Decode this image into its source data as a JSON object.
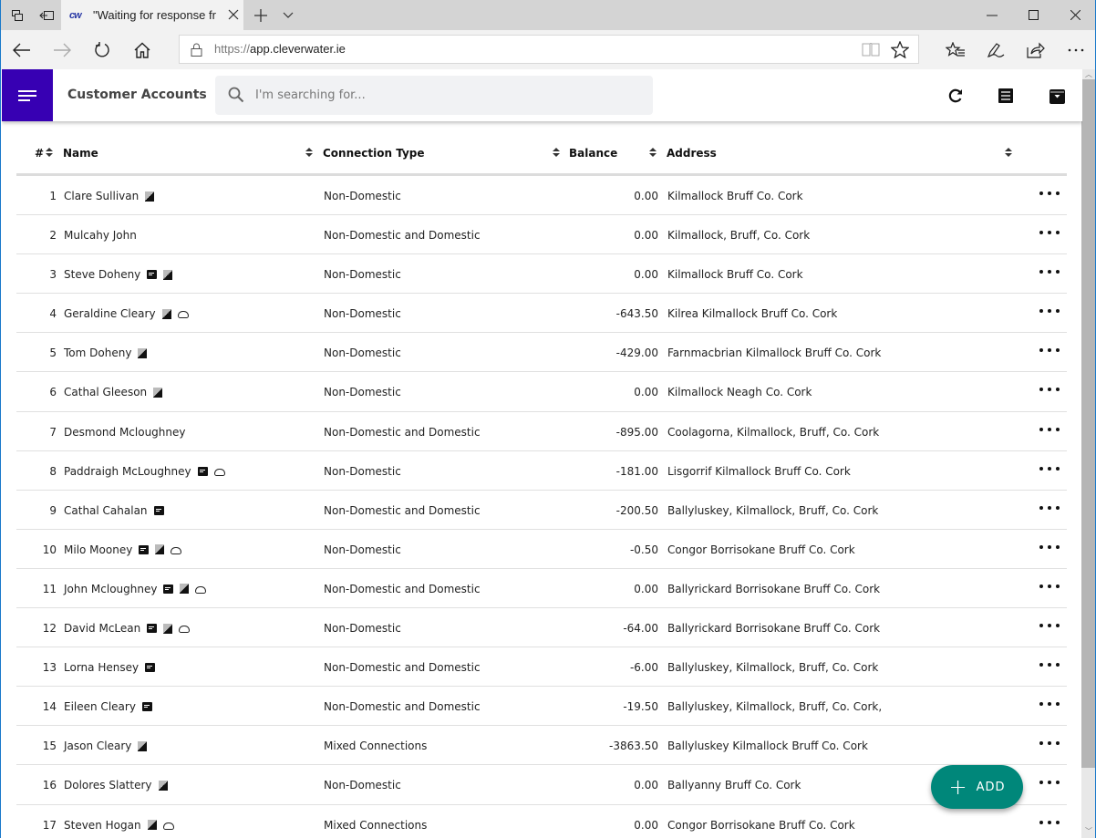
{
  "browser": {
    "tab_title": "\"Waiting for response fr",
    "tab_favicon": "cw",
    "url_scheme": "https://",
    "url_host": "app.cleverwater.ie",
    "icons": [
      "tab-set-aside-icon",
      "tab-restore-icon",
      "close-icon",
      "new-tab-icon",
      "tab-list-chevron-icon",
      "minimize-icon",
      "maximize-icon",
      "close-window-icon",
      "back-icon",
      "forward-icon",
      "refresh-icon",
      "home-icon",
      "lock-icon",
      "reading-view-icon",
      "favorite-star-icon",
      "favorites-hub-icon",
      "web-note-icon",
      "share-icon",
      "more-icon"
    ]
  },
  "app": {
    "title": "Customer Accounts",
    "search_placeholder": "I'm searching for...",
    "header_icons": [
      "refresh-icon",
      "list-icon",
      "archive-icon"
    ],
    "brand_color": "#3700b3",
    "fab_color": "#00877a",
    "fab_label": "ADD"
  },
  "table": {
    "columns": {
      "num": "#",
      "name": "Name",
      "connection": "Connection Type",
      "balance": "Balance",
      "address": "Address"
    },
    "rows": [
      {
        "num": "1",
        "name": "Clare Sullivan",
        "icons": [
          "meter"
        ],
        "connection": "Non-Domestic",
        "balance": "0.00",
        "address": "Kilmallock Bruff Co. Cork"
      },
      {
        "num": "2",
        "name": "Mulcahy John",
        "icons": [],
        "connection": "Non-Domestic and Domestic",
        "balance": "0.00",
        "address": "Kilmallock, Bruff, Co. Cork"
      },
      {
        "num": "3",
        "name": "Steve Doheny",
        "icons": [
          "note",
          "meter"
        ],
        "connection": "Non-Domestic",
        "balance": "0.00",
        "address": "Kilmallock Bruff Co. Cork"
      },
      {
        "num": "4",
        "name": "Geraldine Cleary",
        "icons": [
          "meter",
          "cloud"
        ],
        "connection": "Non-Domestic",
        "balance": "-643.50",
        "address": "Kilrea Kilmallock Bruff Co. Cork"
      },
      {
        "num": "5",
        "name": "Tom Doheny",
        "icons": [
          "meter"
        ],
        "connection": "Non-Domestic",
        "balance": "-429.00",
        "address": "Farnmacbrian Kilmallock Bruff Co. Cork"
      },
      {
        "num": "6",
        "name": "Cathal Gleeson",
        "icons": [
          "meter"
        ],
        "connection": "Non-Domestic",
        "balance": "0.00",
        "address": "Kilmallock Neagh Co. Cork"
      },
      {
        "num": "7",
        "name": "Desmond Mcloughney",
        "icons": [],
        "connection": "Non-Domestic and Domestic",
        "balance": "-895.00",
        "address": "Coolagorna, Kilmallock, Bruff, Co. Cork"
      },
      {
        "num": "8",
        "name": "Paddraigh McLoughney",
        "icons": [
          "note",
          "cloud"
        ],
        "connection": "Non-Domestic",
        "balance": "-181.00",
        "address": "Lisgorrif Kilmallock Bruff Co. Cork"
      },
      {
        "num": "9",
        "name": "Cathal Cahalan",
        "icons": [
          "note"
        ],
        "connection": "Non-Domestic and Domestic",
        "balance": "-200.50",
        "address": "Ballyluskey, Kilmallock, Bruff, Co. Cork"
      },
      {
        "num": "10",
        "name": "Milo Mooney",
        "icons": [
          "note",
          "meter",
          "cloud"
        ],
        "connection": "Non-Domestic",
        "balance": "-0.50",
        "address": "Congor Borrisokane Bruff Co. Cork"
      },
      {
        "num": "11",
        "name": "John Mcloughney",
        "icons": [
          "note",
          "meter",
          "cloud"
        ],
        "connection": "Non-Domestic and Domestic",
        "balance": "0.00",
        "address": "Ballyrickard Borrisokane Bruff Co. Cork"
      },
      {
        "num": "12",
        "name": "David McLean",
        "icons": [
          "note",
          "meter",
          "cloud"
        ],
        "connection": "Non-Domestic",
        "balance": "-64.00",
        "address": "Ballyrickard Borrisokane Bruff Co. Cork"
      },
      {
        "num": "13",
        "name": "Lorna Hensey",
        "icons": [
          "note"
        ],
        "connection": "Non-Domestic and Domestic",
        "balance": "-6.00",
        "address": "Ballyluskey, Kilmallock, Bruff, Co. Cork"
      },
      {
        "num": "14",
        "name": "Eileen Cleary",
        "icons": [
          "note"
        ],
        "connection": "Non-Domestic and Domestic",
        "balance": "-19.50",
        "address": "Ballyluskey, Kilmallock, Bruff, Co. Cork,"
      },
      {
        "num": "15",
        "name": "Jason Cleary",
        "icons": [
          "meter"
        ],
        "connection": "Mixed Connections",
        "balance": "-3863.50",
        "address": "Ballyluskey Kilmallock Bruff Co. Cork"
      },
      {
        "num": "16",
        "name": "Dolores Slattery",
        "icons": [
          "meter"
        ],
        "connection": "Non-Domestic",
        "balance": "0.00",
        "address": "Ballyanny Bruff Co. Cork"
      },
      {
        "num": "17",
        "name": "Steven Hogan",
        "icons": [
          "meter",
          "cloud"
        ],
        "connection": "Mixed Connections",
        "balance": "0.00",
        "address": "Congor Borrisokane Bruff Co. Cork"
      }
    ]
  }
}
